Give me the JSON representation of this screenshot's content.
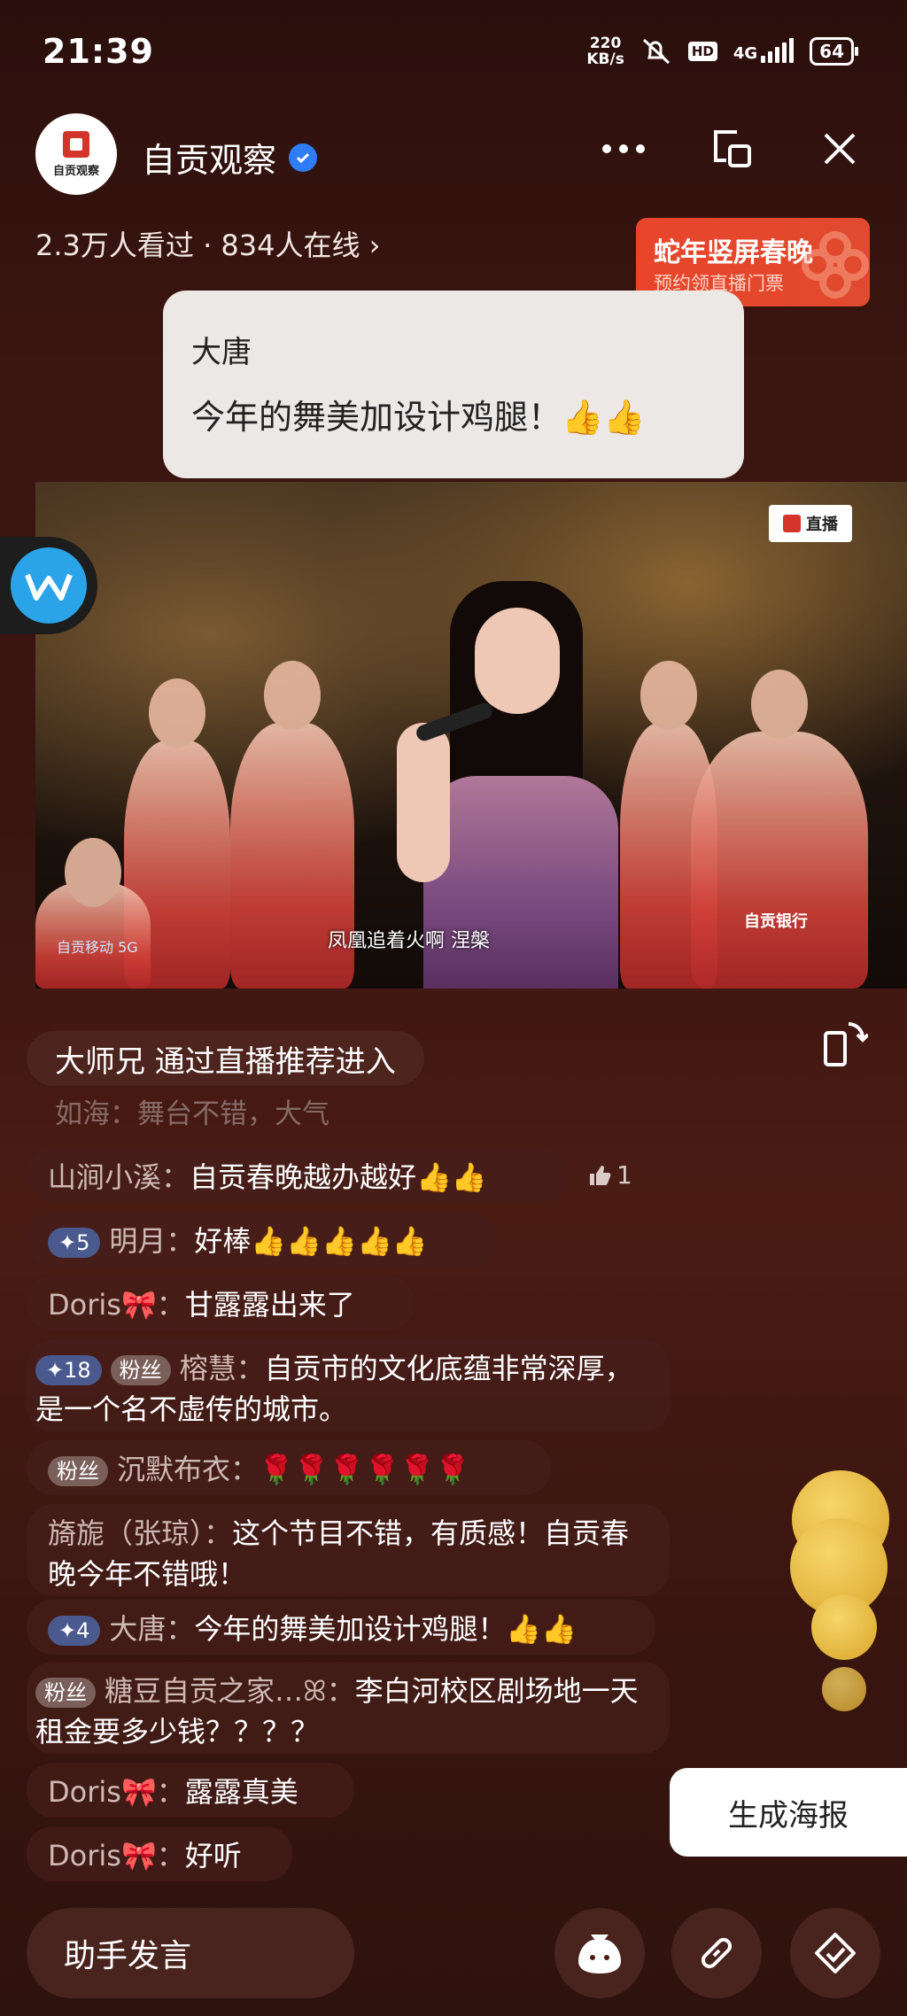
{
  "status_bar": {
    "time": "21:39",
    "net_speed_value": "220",
    "net_speed_unit": "KB/s",
    "hd": "HD",
    "network": "4G",
    "battery": "64"
  },
  "header": {
    "avatar_text": "自贡观察",
    "channel_name": "自贡观察",
    "viewers": "2.3万人看过 · 834人在线 ›"
  },
  "promo": {
    "title": "蛇年竖屏春晚",
    "subtitle": "预约领直播门票"
  },
  "highlight_bubble": {
    "name": "大唐",
    "text": "今年的舞美加设计鸡腿！👍👍"
  },
  "video": {
    "live_badge": "直播",
    "subtitle": "凤凰追着火啊  涅槃",
    "sponsor_left": "自贡移动 5G",
    "sponsor_right": "自贡银行"
  },
  "comments": {
    "entry": "大师兄 通过直播推荐进入",
    "faded": "如海：舞台不错，大气",
    "items": [
      {
        "user": "山涧小溪：",
        "text": "自贡春晚越办越好👍👍"
      },
      {
        "level": "✦5",
        "user": "明月：",
        "text": "好棒👍👍👍👍👍"
      },
      {
        "user": "Doris🎀：",
        "text": "甘露露出来了"
      },
      {
        "level": "✦18",
        "fan": "粉丝",
        "user": "榕慧：",
        "text": "自贡市的文化底蕴非常深厚，是一个名不虚传的城市。"
      },
      {
        "fan": "粉丝",
        "user": "沉默布衣：",
        "text": "🌹🌹🌹🌹🌹🌹"
      },
      {
        "user": "旖旎（张琼）：",
        "text": "这个节目不错，有质感！自贡春晚今年不错哦！"
      },
      {
        "level": "✦4",
        "user": "大唐：",
        "text": "今年的舞美加设计鸡腿！👍👍"
      },
      {
        "fan": "粉丝",
        "user": "糖豆自贡之家…ꕤ：",
        "text": "李白河校区剧场地一天租金要多少钱？？？？"
      },
      {
        "user": "Doris🎀：",
        "text": "露露真美"
      },
      {
        "user": "Doris🎀：",
        "text": "好听"
      }
    ],
    "like_count": "1"
  },
  "actions": {
    "poster_button": "生成海报",
    "assistant_input": "助手发言"
  }
}
